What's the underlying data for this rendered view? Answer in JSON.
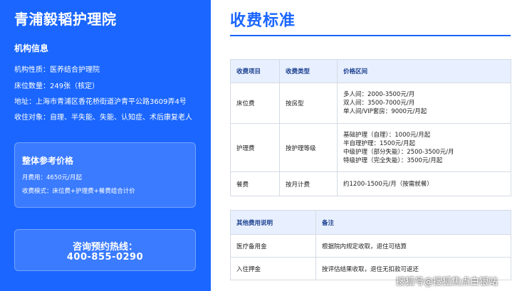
{
  "brand": "青浦毅韬护理院",
  "info": {
    "title": "机构信息",
    "nature": "机构性质：医养结合护理院",
    "beds": "床位数量：249张（核定）",
    "address": "地址：上海市青浦区香花桥街道沪青平公路3609弄4号",
    "targets": "收住对象：自理、半失能、失能、认知症、术后康复老人"
  },
  "price_card": {
    "title": "整体参考价格",
    "monthly": "月费用：4650元/月起",
    "mode": "收费模式：床位费+护理费+餐费组合计价"
  },
  "hotline": {
    "label": "咨询预约热线：",
    "number": "400-855-0290"
  },
  "section_title": "收费标准",
  "fee_table": {
    "headers": [
      "收费项目",
      "收费类型",
      "价格区间"
    ],
    "rows": [
      {
        "item": "床位费",
        "type": "按房型",
        "prices": [
          "多人间：2000-3500元/月",
          "双人间：3500-7000元/月",
          "单人间/VIP套房：9000元/月起"
        ]
      },
      {
        "item": "护理费",
        "type": "按护理等级",
        "prices": [
          "基础护理（自理）：1000元/月起",
          "半自理护理：1500元/月起",
          "中级护理（部分失能）：2500-3500元/月",
          "特级护理（完全失能）：3500元/月起"
        ]
      },
      {
        "item": "餐费",
        "type": "按月计费",
        "prices": [
          "约1200-1500元/月（按需就餐）"
        ]
      }
    ]
  },
  "other_table": {
    "headers": [
      "其他费用说明",
      "备注"
    ],
    "rows": [
      {
        "item": "医疗备用金",
        "note": "根据院内规定收取，退住可结算"
      },
      {
        "item": "入住押金",
        "note": "按评估结果收取，退住无扣款可返还"
      }
    ]
  },
  "watermark": "搜狐号@搜狐焦点白银站"
}
